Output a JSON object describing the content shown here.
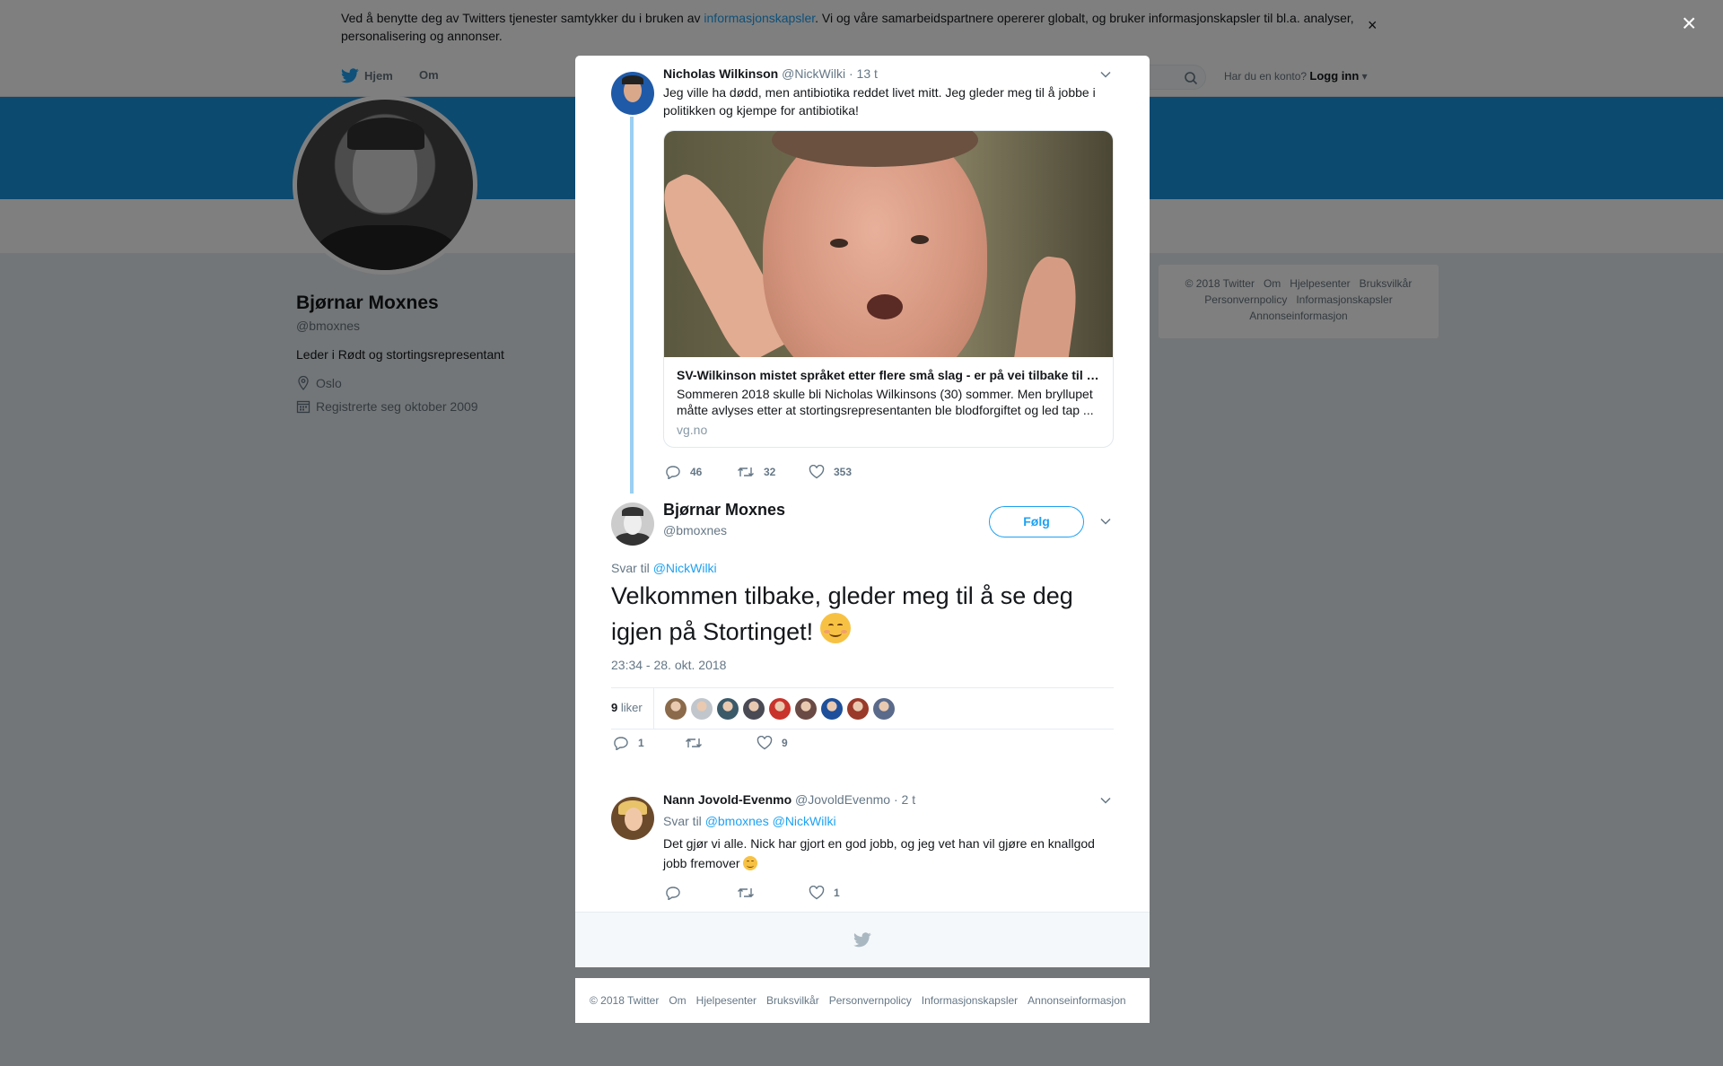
{
  "cookie_banner": {
    "text_before": "Ved å benytte deg av Twitters tjenester samtykker du i bruken av ",
    "link": "informasjonskapsler",
    "text_after": ". Vi og våre samarbeidspartnere opererer globalt, og bruker informasjonskapsler til bl.a. analyser, personalisering og annonser.",
    "close": "×"
  },
  "nav": {
    "home": "Hjem",
    "about": "Om",
    "account_prompt": "Har du en konto?",
    "login": "Logg inn"
  },
  "profile": {
    "name": "Bjørnar Moxnes",
    "handle": "@bmoxnes",
    "bio": "Leder i Rødt og stortingsrepresentant",
    "location": "Oslo",
    "joined": "Registrerte seg oktober 2009"
  },
  "side_footer": [
    "© 2018 Twitter",
    "Om",
    "Hjelpesenter",
    "Bruksvilkår",
    "Personvernpolicy",
    "Informasjonskapsler",
    "Annonseinformasjon"
  ],
  "overlay_close": "×",
  "parent_tweet": {
    "name": "Nicholas Wilkinson",
    "handle": "@NickWilki",
    "time": "· 13 t",
    "text": "Jeg ville ha dødd, men antibiotika reddet livet mitt. Jeg gleder meg til å jobbe i politikken og kjempe for antibiotika!",
    "card": {
      "title": "SV-Wilkinson mistet språket etter flere små slag - er på vei tilbake til Stortinget",
      "description": "Sommeren 2018 skulle bli Nicholas Wilkinsons (30) sommer. Men bryllupet måtte avlyses etter at stortingsrepresentanten ble blodforgiftet og led tap ...",
      "domain": "vg.no"
    },
    "replies": "46",
    "retweets": "32",
    "likes": "353"
  },
  "main_tweet": {
    "name": "Bjørnar Moxnes",
    "handle": "@bmoxnes",
    "follow": "Følg",
    "reply_label": "Svar til",
    "reply_to": "@NickWilki",
    "text": "Velkommen tilbake, gleder meg til å se deg igjen på Stortinget!",
    "timestamp": "23:34 - 28. okt. 2018",
    "likes_number": "9",
    "likes_label": "liker",
    "replies": "1",
    "retweets": "",
    "likes": "9"
  },
  "reply_tweet": {
    "name": "Nann Jovold-Evenmo",
    "handle": "@JovoldEvenmo",
    "time": "· 2 t",
    "reply_label": "Svar til",
    "reply_to_1": "@bmoxnes",
    "reply_to_2": "@NickWilki",
    "text": "Det gjør vi alle. Nick har gjort en god jobb, og jeg vet han vil gjøre en knallgod jobb fremover",
    "replies": "",
    "retweets": "",
    "likes": "1"
  },
  "page_footer": [
    "© 2018 Twitter",
    "Om",
    "Hjelpesenter",
    "Bruksvilkår",
    "Personvernpolicy",
    "Informasjonskapsler",
    "Annonseinformasjon"
  ],
  "colors": {
    "brand_blue": "#1da1f2",
    "banner_blue": "#1b95e0",
    "thread_line": "#9ad0f2",
    "muted_text": "#657786"
  },
  "likers": [
    "#8a6a4a",
    "#c0c6cc",
    "#3a5a6a",
    "#4a4a55",
    "#c8332b",
    "#6a4a44",
    "#1d4f9a",
    "#9a3a2a",
    "#5a6a8a"
  ]
}
